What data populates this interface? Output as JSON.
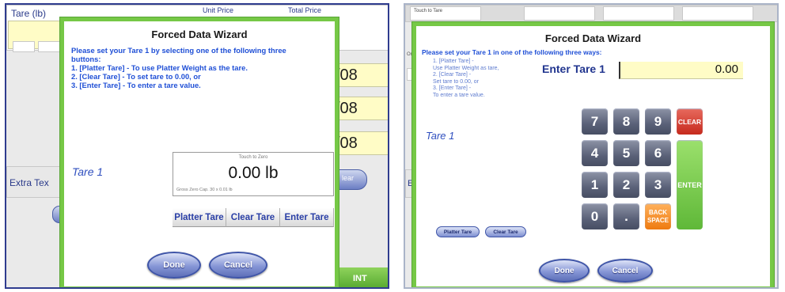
{
  "left": {
    "background": {
      "tare_header": "Tare (lb)",
      "unit_price_header": "Unit Price",
      "total_price_header": "Total Price",
      "date_1": "/08",
      "date_2": "/08",
      "date_3": "/08",
      "extra_text": "Extra Tex",
      "clear_pill": "lear",
      "bottom_green": "INT"
    },
    "dialog": {
      "title": "Forced Data Wizard",
      "instructions": [
        "Please set your Tare 1 by selecting one of the following three",
        "buttons:",
        "1. [Platter Tare] - To use Platter Weight as the tare.",
        "2. [Clear Tare] - To set tare to 0.00, or",
        "3. [Enter Tare] - To enter a tare value."
      ],
      "tare_label": "Tare 1",
      "scale": {
        "touch_to_zero": "Touch to Zero",
        "value": "0.00 lb",
        "status": "Gross  Zero   Cap. 30 x 0.01 lb"
      },
      "buttons": {
        "platter_tare": "Platter Tare",
        "clear_tare": "Clear Tare",
        "enter_tare": "Enter Tare",
        "done": "Done",
        "cancel": "Cancel"
      }
    }
  },
  "right": {
    "background": {
      "tab": "Touch to Tare",
      "left_fragment": "Orc",
      "left_letter": "E"
    },
    "dialog": {
      "title": "Forced Data Wizard",
      "instruction_main": "Please set your Tare 1 in one of the following three ways:",
      "instructions": [
        "1. [Platter Tare] -",
        "Use Platter Weight as tare,",
        "2. [Clear Tare] -",
        "Set tare to 0.00, or",
        "3. [Enter Tare] -",
        "To enter a tare value."
      ],
      "enter_label": "Enter Tare 1",
      "enter_value": "0.00",
      "tare_label": "Tare 1",
      "keypad": {
        "k7": "7",
        "k8": "8",
        "k9": "9",
        "k4": "4",
        "k5": "5",
        "k6": "6",
        "k1": "1",
        "k2": "2",
        "k3": "3",
        "k0": "0",
        "dot": ".",
        "clear": "CLEAR",
        "enter": "ENTER",
        "back": "BACK",
        "space": "SPACE"
      },
      "buttons": {
        "platter_tare": "Platter Tare",
        "clear_tare": "Clear Tare",
        "done": "Done",
        "cancel": "Cancel"
      }
    }
  }
}
